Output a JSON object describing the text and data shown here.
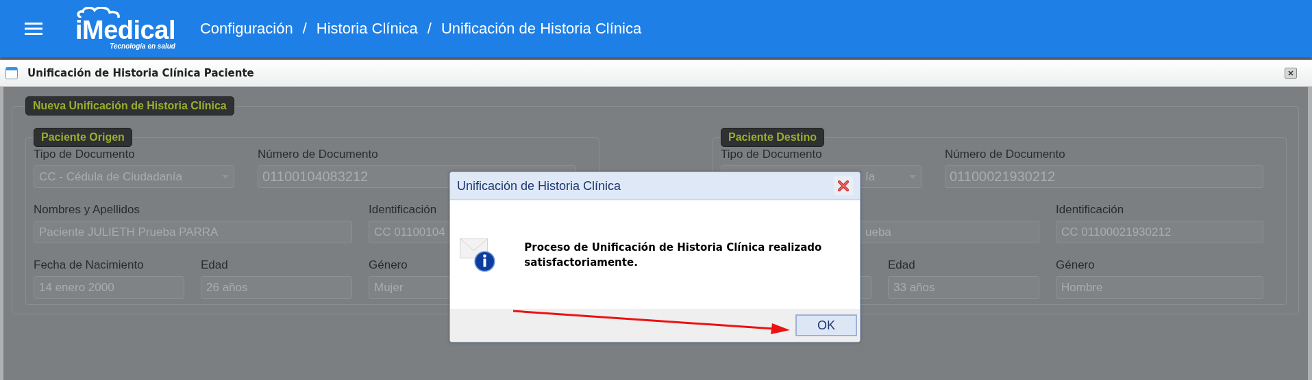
{
  "header": {
    "logo": {
      "name": "iMedical",
      "tagline": "Tecnología en salud"
    },
    "breadcrumb": [
      {
        "label": "Configuración"
      },
      {
        "label": "Historia Clínica"
      },
      {
        "label": "Unificación de Historia Clínica"
      }
    ],
    "separators": [
      "/",
      "/"
    ]
  },
  "panel": {
    "title": "Unificación de Historia Clínica Paciente",
    "group": {
      "legend": "Nueva Unificación de Historia Clínica",
      "patients": [
        {
          "legend": "Paciente Origen",
          "fields": [
            {
              "kind": "select",
              "label": "Tipo de Documento",
              "value": "CC - Cédula de Ciudadanía"
            },
            {
              "kind": "large",
              "label": "Número de Documento",
              "value": "01100104083212"
            },
            {
              "kind": "text",
              "label": "Nombres y Apellidos",
              "value": "Paciente JULIETH Prueba PARRA"
            },
            {
              "kind": "text",
              "label": "Identificación",
              "value": "CC 01100104"
            },
            {
              "kind": "text",
              "label": "Fecha de Nacimiento",
              "value": "14 enero 2000"
            },
            {
              "kind": "text",
              "label": "Edad",
              "value": "26 años"
            },
            {
              "kind": "text",
              "label": "Género",
              "value": "Mujer"
            }
          ]
        },
        {
          "legend": "Paciente Destino",
          "fields": [
            {
              "kind": "select",
              "label": "Tipo de Documento",
              "value": "ía"
            },
            {
              "kind": "large",
              "label": "Número de Documento",
              "value": "01100021930212"
            },
            {
              "kind": "text",
              "value": "ueba"
            },
            {
              "kind": "text",
              "label": "Identificación",
              "value": "CC 01100021930212"
            },
            {
              "kind": "text"
            },
            {
              "kind": "text",
              "label": "Edad",
              "value": "33 años"
            },
            {
              "kind": "text",
              "label": "Género",
              "value": "Hombre"
            }
          ]
        }
      ]
    }
  },
  "dialog": {
    "title": "Unificación de Historia Clínica",
    "message": "Proceso de Unificación de Historia Clínica realizado satisfactoriamente.",
    "button": "OK"
  }
}
